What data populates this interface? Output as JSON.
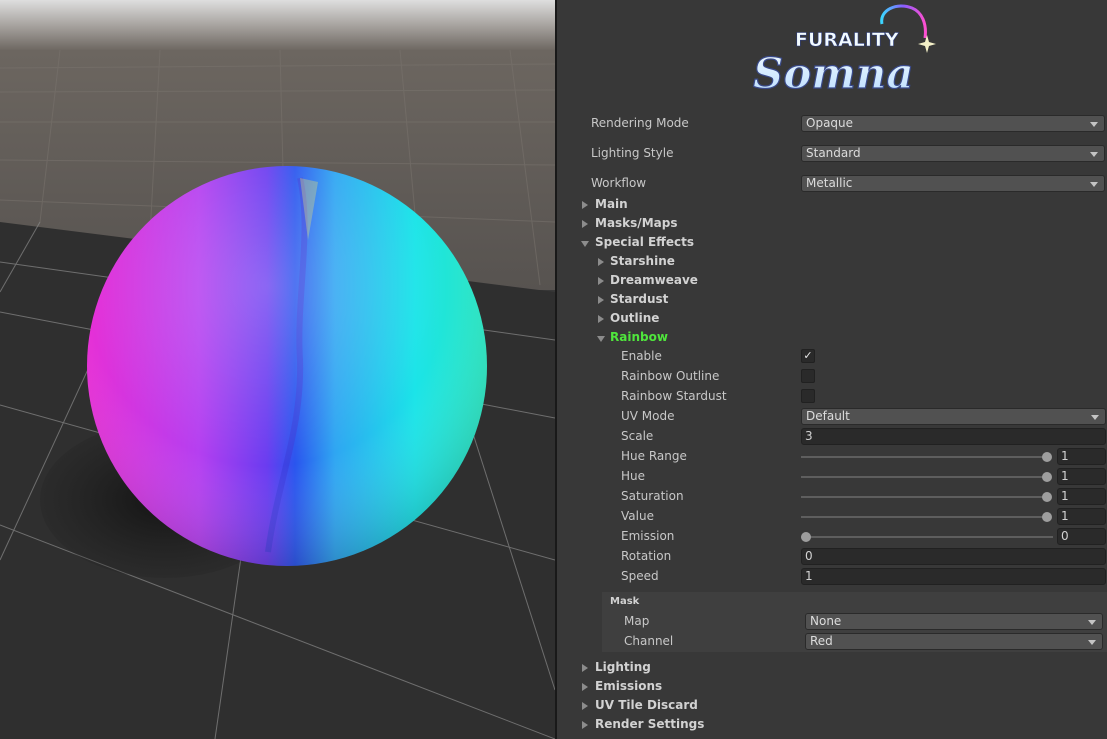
{
  "logo": {
    "line1": "FURALITY",
    "line2": "Somna"
  },
  "colors": {
    "green_label": "#4fe63c",
    "panel_bg": "#383838",
    "scene_ground": "#2f2f2f"
  },
  "rendering_mode": {
    "label": "Rendering Mode",
    "value": "Opaque"
  },
  "lighting_style": {
    "label": "Lighting Style",
    "value": "Standard"
  },
  "workflow": {
    "label": "Workflow",
    "value": "Metallic"
  },
  "sections": {
    "main": "Main",
    "masks_maps": "Masks/Maps",
    "special_effects": "Special Effects",
    "lighting": "Lighting",
    "emissions": "Emissions",
    "uv_tile_discard": "UV Tile Discard",
    "render_settings": "Render Settings"
  },
  "subsections": {
    "starshine": "Starshine",
    "dreamweave": "Dreamweave",
    "stardust": "Stardust",
    "outline": "Outline",
    "rainbow": "Rainbow"
  },
  "rainbow": {
    "enable": {
      "label": "Enable",
      "checked": true,
      "check_glyph": "✓"
    },
    "rainbow_outline": {
      "label": "Rainbow Outline",
      "checked": false
    },
    "rainbow_stardust": {
      "label": "Rainbow Stardust",
      "checked": false
    },
    "uv_mode": {
      "label": "UV Mode",
      "value": "Default"
    },
    "scale": {
      "label": "Scale",
      "value": "3"
    },
    "hue_range": {
      "label": "Hue Range",
      "value": "1"
    },
    "hue": {
      "label": "Hue",
      "value": "1"
    },
    "saturation": {
      "label": "Saturation",
      "value": "1"
    },
    "value": {
      "label": "Value",
      "value": "1"
    },
    "emission": {
      "label": "Emission",
      "value": "0"
    },
    "rotation": {
      "label": "Rotation",
      "value": "0"
    },
    "speed": {
      "label": "Speed",
      "value": "1"
    },
    "mask": {
      "title": "Mask",
      "map": {
        "label": "Map",
        "value": "None"
      },
      "channel": {
        "label": "Channel",
        "value": "Red"
      }
    }
  }
}
